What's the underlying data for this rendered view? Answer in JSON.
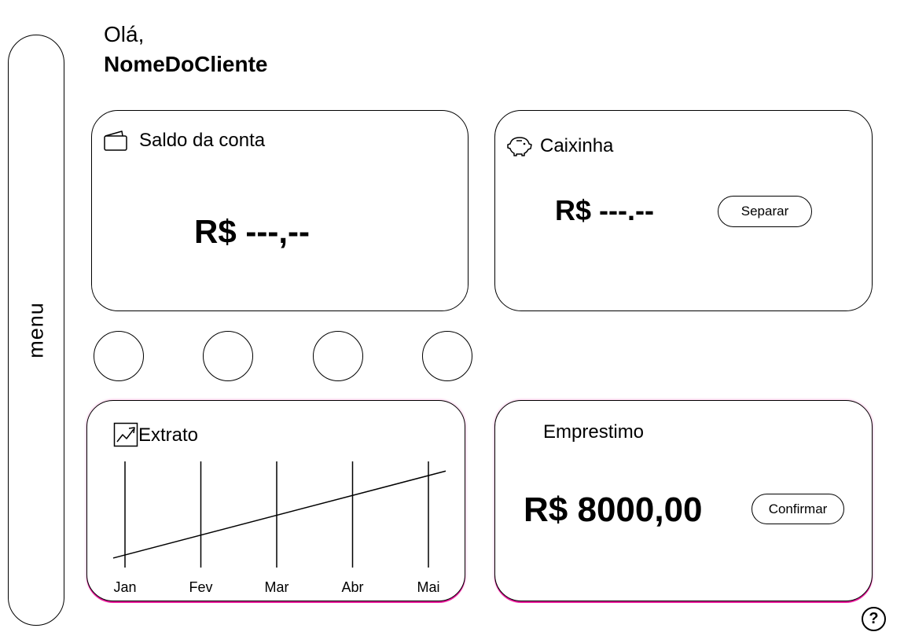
{
  "menu": {
    "label": "menu"
  },
  "header": {
    "greeting": "Olá,",
    "client_name": "NomeDoCliente"
  },
  "saldo": {
    "title": "Saldo da conta",
    "icon": "wallet-icon",
    "value": "R$ ---,--"
  },
  "caixinha": {
    "title": "Caixinha",
    "icon": "piggy-bank-icon",
    "value": "R$ ---.--",
    "button_label": "Separar"
  },
  "quick_actions": {
    "count": 4
  },
  "extrato": {
    "title": "Extrato",
    "icon": "chart-line-icon",
    "chart_data": {
      "type": "line",
      "categories": [
        "Jan",
        "Fev",
        "Mar",
        "Abr",
        "Mai"
      ],
      "series": [
        {
          "values": [
            1,
            2,
            3,
            4,
            5
          ]
        }
      ]
    }
  },
  "emprestimo": {
    "title": "Emprestimo",
    "value": "R$ 8000,00",
    "button_label": "Confirmar"
  },
  "help": {
    "label": "?",
    "icon": "help-icon"
  }
}
